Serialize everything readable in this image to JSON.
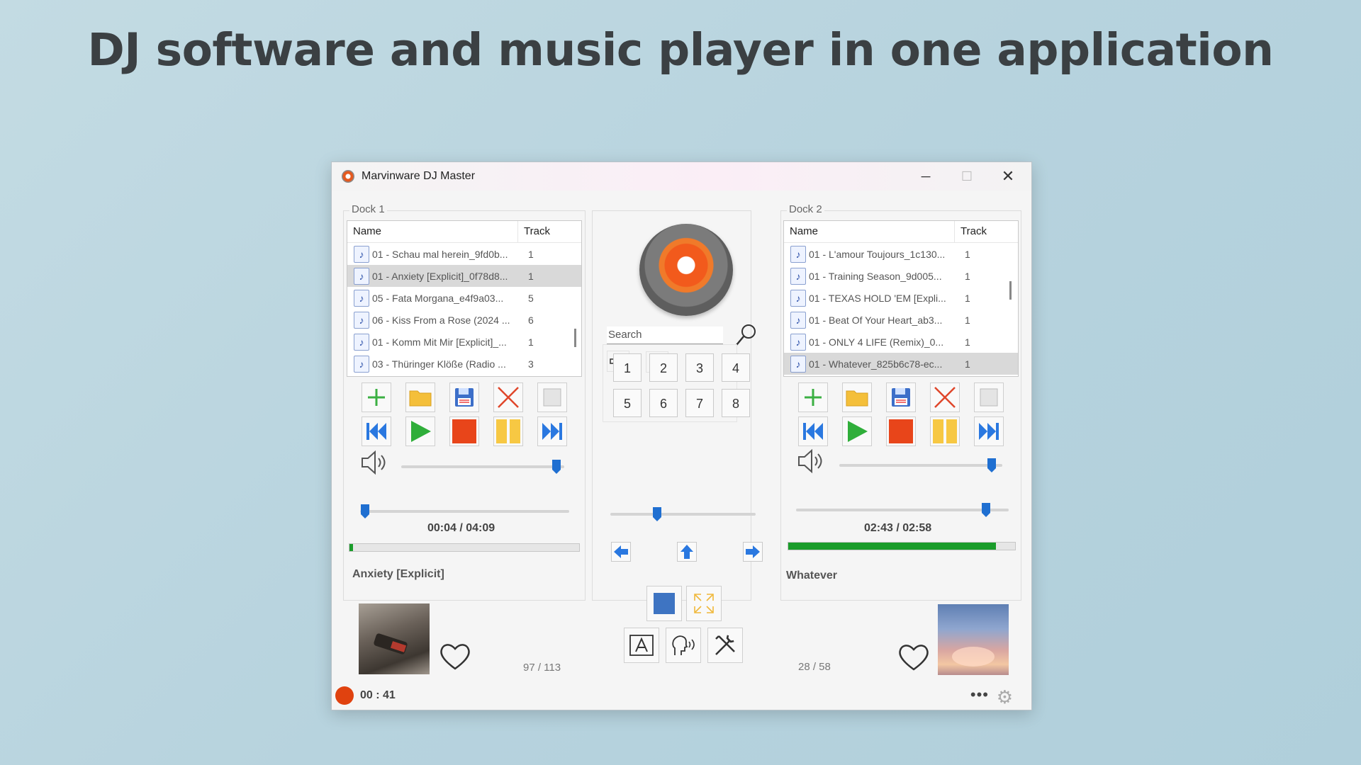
{
  "headline": "DJ software and music player in one application",
  "window": {
    "title": "Marvinware DJ Master",
    "controls": {
      "minimize": "─",
      "maximize": "☐",
      "close": "✕"
    }
  },
  "dock1": {
    "label": "Dock 1",
    "columns": {
      "name": "Name",
      "track": "Track"
    },
    "rows": [
      {
        "name": "01 - Schau mal herein_9fd0b...",
        "track": "1"
      },
      {
        "name": "01 - Anxiety [Explicit]_0f78d8...",
        "track": "1"
      },
      {
        "name": "05 - Fata Morgana_e4f9a03...",
        "track": "5"
      },
      {
        "name": "06 - Kiss From a Rose (2024 ...",
        "track": "6"
      },
      {
        "name": "01 - Komm Mit Mir [Explicit]_...",
        "track": "1"
      },
      {
        "name": "03 - Thüringer Klöße (Radio ...",
        "track": "3"
      }
    ],
    "selected_index": 1,
    "time": "00:04 /  04:09",
    "progress_fraction": 0.016,
    "volume_fraction": 1.0,
    "song_title": "Anxiety [Explicit]",
    "counter": "97 / 113"
  },
  "dock2": {
    "label": "Dock 2",
    "columns": {
      "name": "Name",
      "track": "Track"
    },
    "rows": [
      {
        "name": "01 - L'amour Toujours_1c130...",
        "track": "1"
      },
      {
        "name": "01 - Training Season_9d005...",
        "track": "1"
      },
      {
        "name": "01 - TEXAS HOLD 'EM [Expli...",
        "track": "1"
      },
      {
        "name": "01 - Beat Of Your Heart_ab3...",
        "track": "1"
      },
      {
        "name": "01 - ONLY 4 LIFE (Remix)_0...",
        "track": "1"
      },
      {
        "name": "01 - Whatever_825b6c78-ec...",
        "track": "1"
      }
    ],
    "selected_index": 5,
    "time": "02:43 /  02:58",
    "progress_fraction": 0.916,
    "volume_fraction": 1.0,
    "song_title": "Whatever",
    "counter": "28 / 58"
  },
  "center": {
    "search_placeholder": "Search",
    "numpad": [
      "1",
      "2",
      "3",
      "4",
      "5",
      "6",
      "7",
      "8"
    ],
    "crossfader_fraction": 0.33
  },
  "status": {
    "record_time": "00 : 41",
    "more": "•••"
  },
  "icons": {
    "add": "plus-icon",
    "open": "folder-icon",
    "save": "floppy-icon",
    "delete": "x-icon",
    "clear": "blank-icon",
    "prev": "skip-back-icon",
    "play": "play-icon",
    "stop": "stop-icon",
    "pause": "pause-icon",
    "next": "skip-forward-icon"
  },
  "colors": {
    "accent_blue": "#1f6fd1",
    "progress_green": "#1a9c2a",
    "record_red": "#e0420f",
    "stop_red": "#e8451a",
    "pause_yellow": "#f7c843",
    "play_green": "#2fae3a"
  }
}
